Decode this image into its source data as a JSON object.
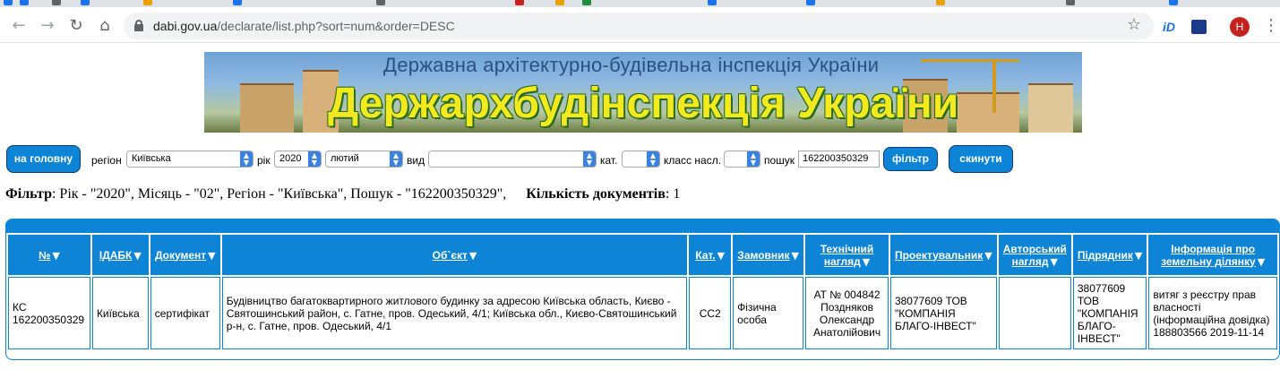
{
  "browser": {
    "url_host": "dabi.gov.ua",
    "url_path": "/declarate/list.php?sort=num&order=DESC",
    "avatar_letter": "Н",
    "ext_id_label": "iD"
  },
  "banner": {
    "subtitle": "Державна архітектурно-будівельна інспекція України",
    "title": "Держархбудінспекція України"
  },
  "filters": {
    "home_button": "на головну",
    "region_label": "регіон",
    "region_value": "Київська",
    "year_label": "рік",
    "year_value": "2020",
    "month_value": "лютий",
    "type_label": "вид",
    "type_value": "",
    "category_label": "кат.",
    "category_value": "",
    "class_label": "класс насл.",
    "class_value": "",
    "search_label": "пошук",
    "search_value": "162200350329",
    "filter_button": "фільтр",
    "reset_button": "скинути"
  },
  "summary": {
    "filter_label": "Фільтр",
    "filter_text": ": Рік - \"2020\", Місяць - \"02\", Регіон - \"Київська\", Пошук - \"162200350329\",",
    "count_label": "Кількість документів",
    "count_value": ": 1"
  },
  "table": {
    "headers": [
      {
        "line1": "№",
        "line2": ""
      },
      {
        "line1": "ІДАБК",
        "line2": ""
      },
      {
        "line1": "Документ",
        "line2": ""
      },
      {
        "line1": "Об`єкт",
        "line2": ""
      },
      {
        "line1": "Кат.",
        "line2": ""
      },
      {
        "line1": "Замовник",
        "line2": ""
      },
      {
        "line1": "Технічний",
        "line2": "нагляд"
      },
      {
        "line1": "Проектувальник",
        "line2": ""
      },
      {
        "line1": "Авторський",
        "line2": "нагляд"
      },
      {
        "line1": "Підрядник",
        "line2": ""
      },
      {
        "line1": "Інформація про",
        "line2": "земельну ділянку"
      }
    ],
    "sort_indicator": "▼",
    "rows": [
      {
        "num": "КС 162200350329",
        "idabk": "Київська",
        "document": "сертифікат",
        "object": "Будівництво багатоквартирного житлового будинку за адресою Київська область, Києво - Святошинський район, с. Гатне, пров. Одеський, 4/1; Київська обл., Києво-Святошинський р-н, с. Гатне, пров. Одеський, 4/1",
        "category": "СС2",
        "customer": "Фізична особа",
        "tech_supervision": "АТ № 004842 Поздняков Олександр Анатолійович",
        "designer": "38077609 ТОВ \"КОМПАНІЯ БЛАГО-ІНВЕСТ\"",
        "author_supervision": "",
        "contractor": "38077609 ТОВ \"КОМПАНІЯ БЛАГО-ІНВЕСТ\"",
        "land_info": "витяг з реєстру прав власності (інформаційна довідка) 188803566 2019-11-14"
      }
    ]
  }
}
